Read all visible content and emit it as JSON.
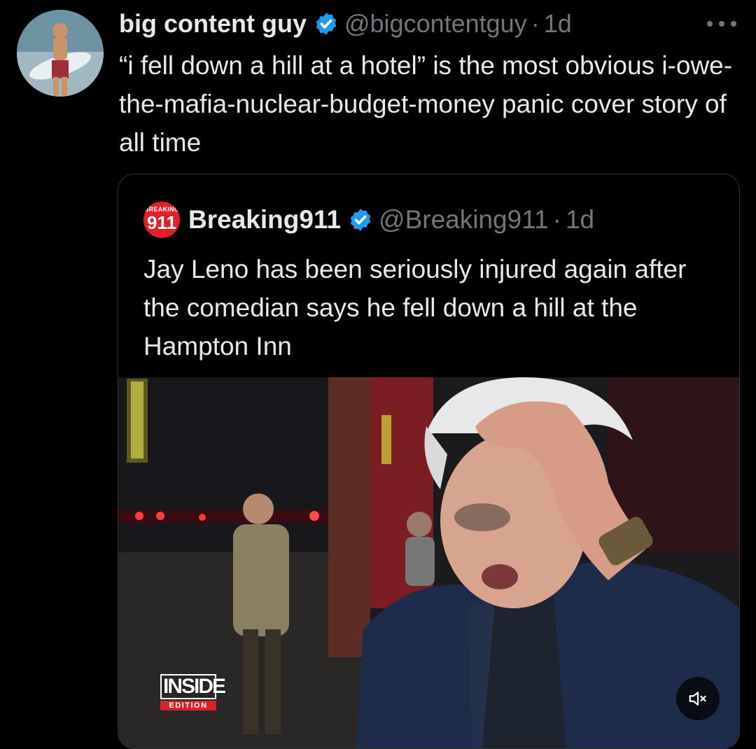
{
  "tweet": {
    "display_name": "big content guy",
    "handle": "@bigcontentguy",
    "separator": "·",
    "time": "1d",
    "text": "“i fell down a hill at a hotel” is the most obvious i-owe-the-mafia-nuclear-budget-money panic cover story of all time",
    "avatar_icon": "surfer-avatar",
    "verified_icon": "verified-badge-icon",
    "more_icon": "more-options-icon"
  },
  "quoted": {
    "logo_top_text": "BREAKING",
    "logo_number": "911",
    "display_name": "Breaking911",
    "handle": "@Breaking911",
    "separator": "·",
    "time": "1d",
    "text": "Jay Leno has been seriously injured again after the comedian says he fell down a hill at the Hampton Inn",
    "video": {
      "watermark_top": "INSIDE",
      "watermark_bottom": "EDITION",
      "mute_icon": "muted-speaker-icon"
    }
  },
  "colors": {
    "background": "#000000",
    "text_primary": "#e7e9ea",
    "text_secondary": "#71767b",
    "verified": "#1d9bf0",
    "border": "#2f3336",
    "breaking_red": "#e12029"
  }
}
